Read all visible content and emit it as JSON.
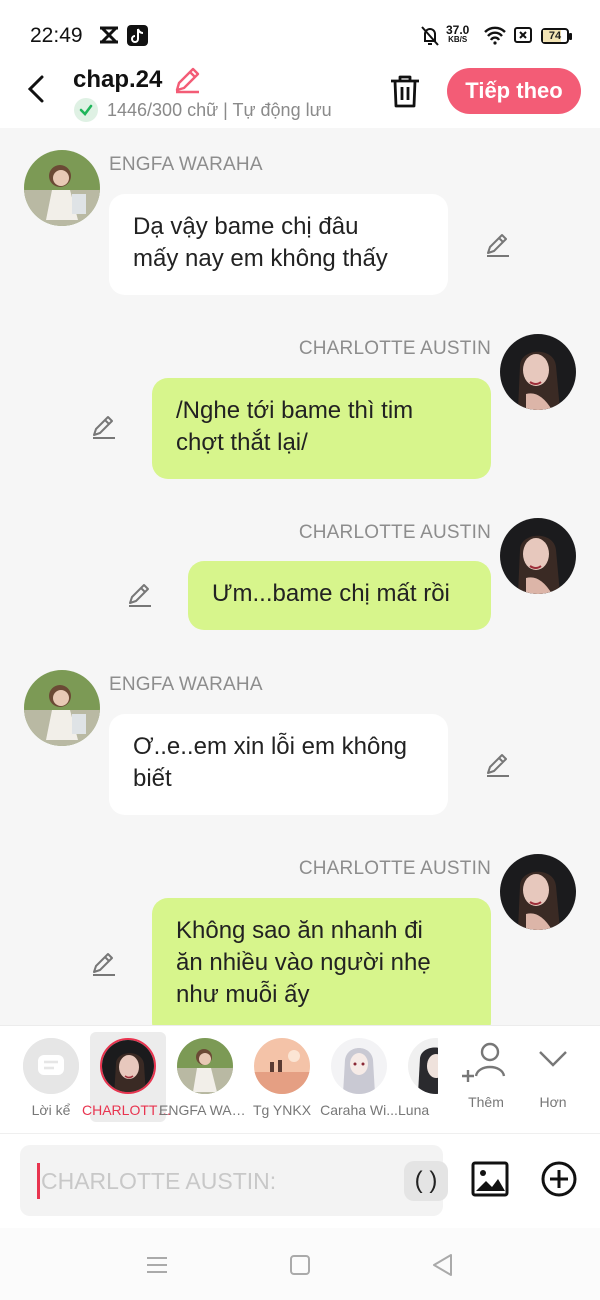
{
  "status_bar": {
    "time": "22:49",
    "network_speed": "37.0",
    "network_unit": "KB/S",
    "battery_level": "74",
    "battery_fraction": 0.74,
    "icons": [
      "capcut-icon",
      "tiktok-icon",
      "mute-bell-icon",
      "wifi-icon",
      "sim-icon",
      "battery-icon"
    ]
  },
  "header": {
    "title": "chap.24",
    "subline": "1446/300 chữ | Tự động lưu",
    "next_button": "Tiếp theo",
    "accent_color": "#f35c76"
  },
  "messages": [
    {
      "side": "left",
      "name": "ENGFA WARAHA",
      "text_lines": [
        "Dạ vậy bame chị đâu",
        "mấy nay em không thấy"
      ]
    },
    {
      "side": "right",
      "name": "CHARLOTTE AUSTIN",
      "text_lines": [
        "/Nghe tới bame thì tim",
        "chợt thắt lại/"
      ]
    },
    {
      "side": "right",
      "name": "CHARLOTTE AUSTIN",
      "text_lines": [
        "Ưm...bame chị mất rồi"
      ]
    },
    {
      "side": "left",
      "name": "ENGFA WARAHA",
      "text_lines": [
        "Ơ..e..em xin lỗi em không",
        "biết"
      ]
    },
    {
      "side": "right",
      "name": "CHARLOTTE AUSTIN",
      "text_lines": [
        "Không sao ăn nhanh đi",
        "ăn nhiều vào người nhẹ",
        "như muỗi ấy"
      ]
    }
  ],
  "characters": [
    {
      "label": "Lời kể",
      "selected": false
    },
    {
      "label": "CHARLOTTE AUSTIN",
      "selected": true
    },
    {
      "label": "ENGFA WARAHA",
      "selected": false
    },
    {
      "label": "Tg YNKX",
      "selected": false
    },
    {
      "label": "Caraha Wi...",
      "selected": false
    },
    {
      "label": "Luna",
      "selected": false
    }
  ],
  "tools": {
    "add": "Thêm",
    "more": "Hơn"
  },
  "input": {
    "placeholder": "CHARLOTTE AUSTIN:",
    "paren": "( )"
  },
  "colors": {
    "right_bubble": "#d7f58c",
    "left_bubble": "#ffffff",
    "selected": "#e8344f"
  }
}
